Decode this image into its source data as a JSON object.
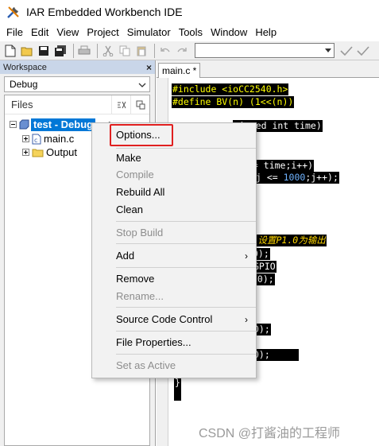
{
  "window": {
    "title": "IAR Embedded Workbench IDE"
  },
  "menubar": [
    "File",
    "Edit",
    "View",
    "Project",
    "Simulator",
    "Tools",
    "Window",
    "Help"
  ],
  "workspace": {
    "header": "Workspace",
    "close_glyph": "×",
    "configuration": "Debug",
    "files_column": "Files",
    "check_glyph": "✔",
    "tree": {
      "project": "test - Debug",
      "children": [
        "main.c",
        "Output"
      ]
    }
  },
  "editor": {
    "tab_label": "main.c *",
    "lines": [
      {
        "parts": [
          {
            "t": "#include <ioCC2540.h>",
            "c": "kw"
          }
        ]
      },
      {
        "parts": [
          {
            "t": "#define BV(n) (1<<(n))",
            "c": "kw"
          }
        ]
      },
      {
        "parts": [
          {
            "t": "signed int time)",
            "c": ""
          }
        ]
      },
      {
        "parts": [
          {
            "t": "<= time;i++)",
            "c": ""
          }
        ]
      },
      {
        "parts": [
          {
            "t": "j <= ",
            "c": ""
          },
          {
            "t": "1000",
            "c": "num"
          },
          {
            "t": ";j++);",
            "c": ""
          }
        ]
      },
      {
        "parts": [
          {
            "t": "，设置P1.0为输出",
            "c": "cm"
          }
        ]
      },
      {
        "parts": [
          {
            "t": "0);",
            "c": ""
          }
        ]
      },
      {
        "parts": [
          {
            "t": "GPIO",
            "c": ""
          }
        ]
      },
      {
        "parts": [
          {
            "t": "(0);",
            "c": ""
          }
        ]
      },
      {
        "parts": [
          {
            "t": "0);",
            "c": ""
          }
        ]
      },
      {
        "parts": [
          {
            "t": "0);",
            "c": ""
          }
        ]
      },
      {
        "parts": [
          {
            "t": "}",
            "c": ""
          }
        ]
      }
    ]
  },
  "context_menu": {
    "items": [
      {
        "label": "Options...",
        "enabled": true
      },
      {
        "label": "Make",
        "enabled": true
      },
      {
        "label": "Compile",
        "enabled": false
      },
      {
        "label": "Rebuild All",
        "enabled": true
      },
      {
        "label": "Clean",
        "enabled": true
      },
      {
        "label": "Stop Build",
        "enabled": false
      },
      {
        "label": "Add",
        "enabled": true,
        "submenu": true
      },
      {
        "label": "Remove",
        "enabled": true
      },
      {
        "label": "Rename...",
        "enabled": false
      },
      {
        "label": "Source Code Control",
        "enabled": true,
        "submenu": true
      },
      {
        "label": "File Properties...",
        "enabled": true
      },
      {
        "label": "Set as Active",
        "enabled": false
      }
    ],
    "submenu_glyph": "›",
    "highlighted_item": "Options..."
  },
  "watermark": "CSDN @打酱油的工程师",
  "colors": {
    "accent_selection": "#0078d7",
    "highlight_box": "#e02020",
    "workspace_header": "#c9d6e9"
  }
}
